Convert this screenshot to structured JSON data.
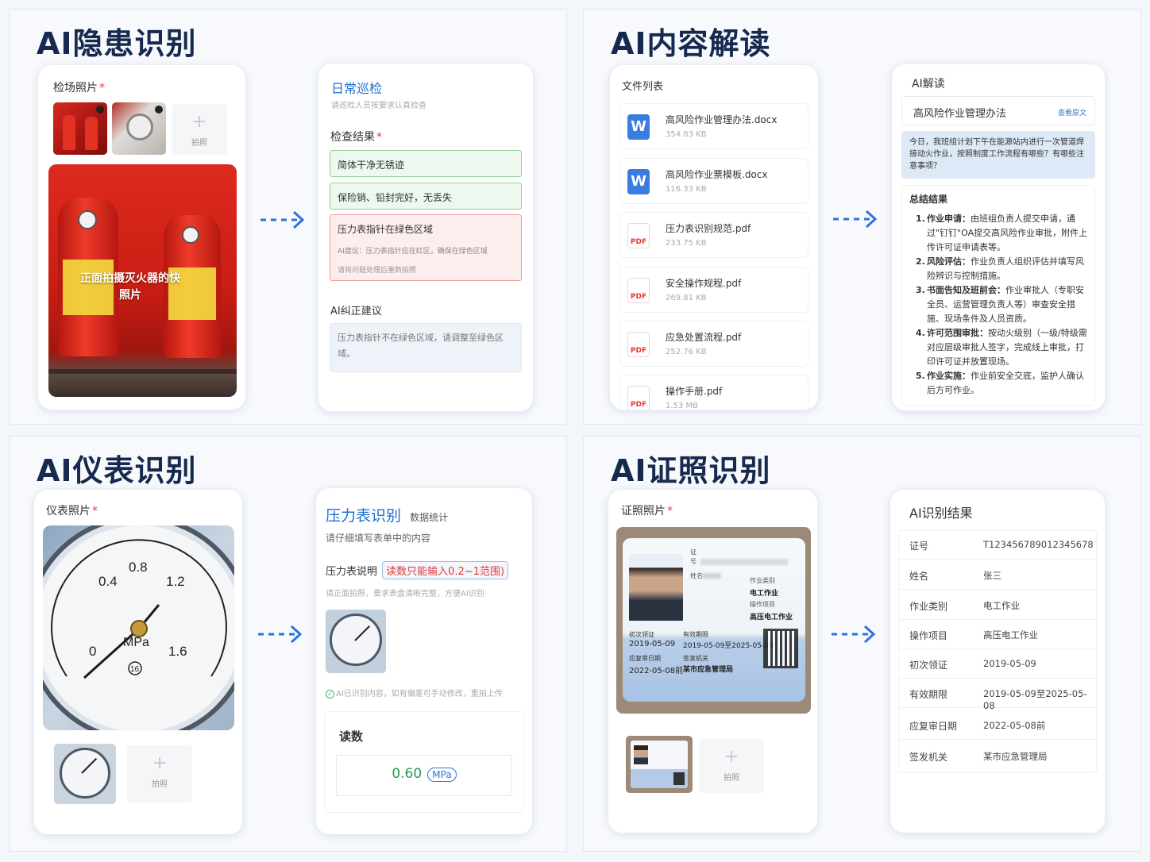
{
  "q1": {
    "title": "AI隐患识别",
    "photo_label": "检场照片",
    "req": "*",
    "add_label": "拍照",
    "photo_overlay": "正面拍摄灭火器的快照片",
    "form_title": "日常巡检",
    "form_subtitle": "请巡检人员按要求认真检查",
    "result_label": "检查结果",
    "checks": [
      {
        "text": "简体干净无锈迹",
        "status": "ok"
      },
      {
        "text": "保险销、铅封完好，无丢失",
        "status": "ok"
      }
    ],
    "bad_check": {
      "text": "压力表指针在绿色区域",
      "ai_note": "AI建议：压力表指针应在红区，确保在绿色区域",
      "hint": "请将问题处理后重新拍照"
    },
    "correction_label": "AI纠正建议",
    "correction_text": "压力表指针不在绿色区域，请调整至绿色区域。"
  },
  "q2": {
    "title": "AI内容解读",
    "list_label": "文件列表",
    "files": [
      {
        "name": "高风险作业管理办法.docx",
        "size": "354.83 KB",
        "type": "word"
      },
      {
        "name": "高风险作业票模板.docx",
        "size": "116.33 KB",
        "type": "word"
      },
      {
        "name": "压力表识别规范.pdf",
        "size": "233.75 KB",
        "type": "pdf"
      },
      {
        "name": "安全操作规程.pdf",
        "size": "269.81 KB",
        "type": "pdf"
      },
      {
        "name": "应急处置流程.pdf",
        "size": "252.76 KB",
        "type": "pdf"
      },
      {
        "name": "操作手册.pdf",
        "size": "1.53 MB",
        "type": "pdf"
      }
    ],
    "word_icon": "W",
    "pdf_icon": "PDF",
    "ai_label": "AI解读",
    "doc_title": "高风险作业管理办法",
    "view_original": "查看原文",
    "question": "今日，我班组计划下午在能源站内进行一次管道焊接动火作业，按照制度工作流程有哪些？有哪些注意事项？",
    "summary_label": "总结结果",
    "summary": [
      {
        "n": "1.",
        "head": "作业申请：",
        "text": "由班组负责人提交申请，通过\"钉钉\"OA提交高风险作业审批，附件上传许可证申请表等。"
      },
      {
        "n": "2.",
        "head": "风险评估：",
        "text": "作业负责人组织评估并填写风险辨识与控制措施。"
      },
      {
        "n": "3.",
        "head": "书面告知及班前会：",
        "text": "作业审批人（专职安全员、运营管理负责人等）审查安全措施、现场条件及人员资质。"
      },
      {
        "n": "4.",
        "head": "许可范围审批：",
        "text": "按动火级别（一级/特级需对应层级审批人签字，完成线上审批，打印许可证并放置现场。"
      },
      {
        "n": "5.",
        "head": "作业实施：",
        "text": "作业前安全交底，监护人确认后方可作业。"
      }
    ]
  },
  "q3": {
    "title": "AI仪表识别",
    "photo_label": "仪表照片",
    "req": "*",
    "add_label": "拍照",
    "gauge_labels": {
      "a": "0.4",
      "b": "0.8",
      "c": "1.2",
      "d": "1.6",
      "e": "0",
      "unit": "MPa",
      "badge": "16"
    },
    "form_title": "压力表识别",
    "form_title_sub": "数据统计",
    "form_subtitle": "请仔细填写表单中的内容",
    "desc_label": "压力表说明",
    "desc_hint": "读数只能输入0.2~1范围)",
    "desc_sub": "请正面拍照，要求表盘清晰完整，方便AI识别",
    "ai_note": "AI已识别内容，如有偏差可手动修改，重拍上传",
    "reading_label": "读数",
    "reading_value": "0.60",
    "reading_unit": "MPa"
  },
  "q4": {
    "title": "AI证照识别",
    "photo_label": "证照照片",
    "req": "*",
    "add_label": "拍照",
    "card_text": {
      "cert": "证",
      "no": "号",
      "name": "姓名",
      "cat_label": "作业类别",
      "cat": "电工作业",
      "item_label": "操作项目",
      "item": "高压电工作业",
      "first_label": "初次领证",
      "first": "2019-05-09",
      "valid_label": "有效期限",
      "valid": "2019-05-09至2025-05-08",
      "review_label": "应复审日期",
      "review": "2022-05-08前",
      "org_label": "签发机关",
      "org": "某市应急管理局"
    },
    "result_label": "AI识别结果",
    "results": [
      {
        "k": "证号",
        "v": "T123456789012345678"
      },
      {
        "k": "姓名",
        "v": "张三"
      },
      {
        "k": "作业类别",
        "v": "电工作业"
      },
      {
        "k": "操作项目",
        "v": "高压电工作业"
      },
      {
        "k": "初次领证",
        "v": "2019-05-09"
      },
      {
        "k": "有效期限",
        "v": "2019-05-09至2025-05-08"
      },
      {
        "k": "应复审日期",
        "v": "2022-05-08前"
      },
      {
        "k": "签发机关",
        "v": "某市应急管理局"
      }
    ]
  },
  "colors": {
    "accent": "#1d6fd1",
    "title": "#16294f",
    "ok": "#91d39a",
    "bad": "#f19b9b"
  }
}
